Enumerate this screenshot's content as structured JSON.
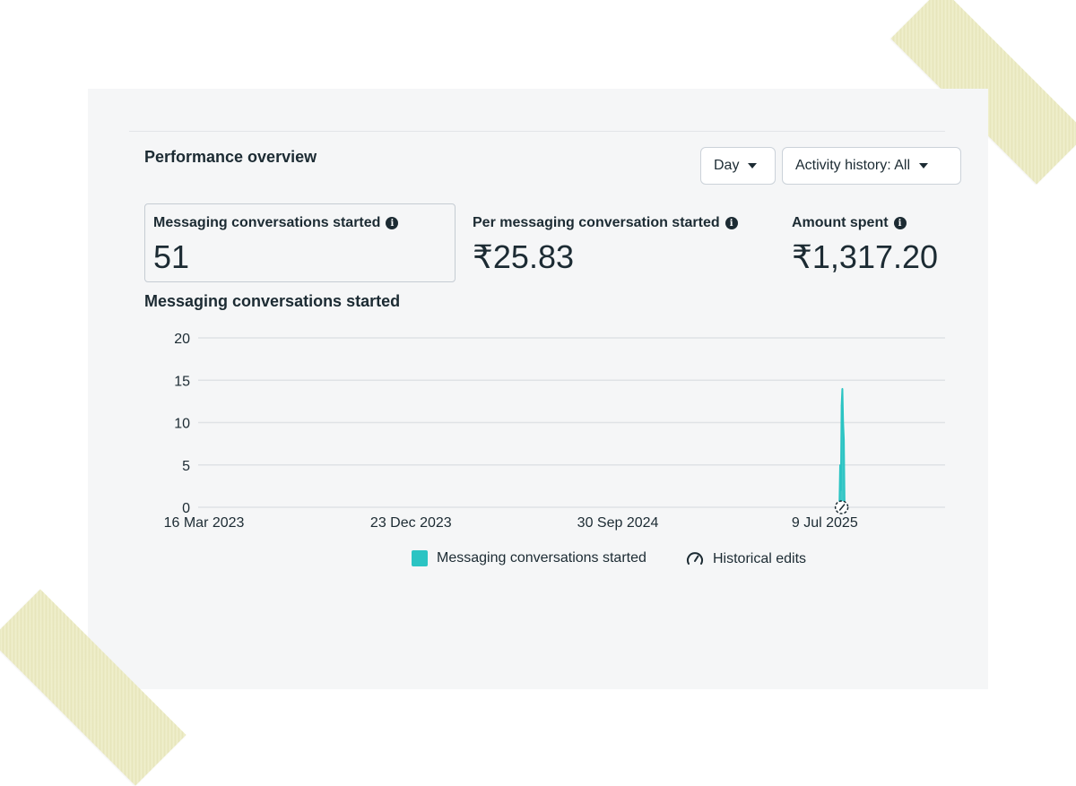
{
  "header": {
    "title": "Performance overview",
    "day_label": "Day",
    "activity_label": "Activity history: All"
  },
  "metrics": [
    {
      "label": "Messaging conversations started",
      "value": "51",
      "selected": true
    },
    {
      "label": "Per messaging conversation started",
      "value": "₹25.83",
      "selected": false
    },
    {
      "label": "Amount spent",
      "value": "₹1,317.20",
      "selected": false
    }
  ],
  "icons": {
    "info": "info-icon",
    "caret": "caret-down-icon",
    "historical_edits": "gauge-icon"
  },
  "colors": {
    "series": "#2bc4c3",
    "grid": "#dfe2e6",
    "text": "#1c2b33"
  },
  "chart_data": {
    "type": "area",
    "title": "Messaging conversations started",
    "xlabel": "",
    "ylabel": "",
    "ylim": [
      0,
      20
    ],
    "yticks": [
      0,
      5,
      10,
      15,
      20
    ],
    "xlim": [
      "2023-03-08",
      "2025-12-20"
    ],
    "xticks": [
      "2023-03-16",
      "2023-12-23",
      "2024-09-30",
      "2025-07-09"
    ],
    "xtick_labels": [
      "16 Mar 2023",
      "23 Dec 2023",
      "30 Sep 2024",
      "9 Jul 2025"
    ],
    "grid": true,
    "series": [
      {
        "name": "Messaging conversations started",
        "x": [
          "2025-07-29",
          "2025-07-30",
          "2025-07-31",
          "2025-08-01",
          "2025-08-02",
          "2025-08-03",
          "2025-08-04",
          "2025-08-05"
        ],
        "values": [
          0,
          5,
          2,
          12,
          14,
          10,
          8,
          0
        ]
      }
    ],
    "legend": {
      "position": "bottom",
      "entries": [
        "Messaging conversations started",
        "Historical edits"
      ]
    },
    "annotations": [
      {
        "type": "historical-edit-marker",
        "x": "2025-08-01"
      }
    ]
  }
}
